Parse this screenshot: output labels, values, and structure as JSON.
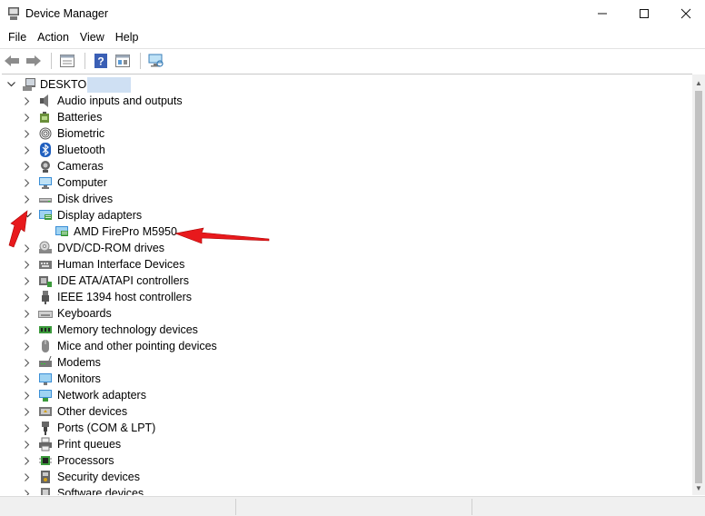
{
  "window": {
    "title": "Device Manager",
    "minimize_icon": "minimize-icon",
    "maximize_icon": "maximize-icon",
    "close_icon": "close-icon"
  },
  "menu": {
    "items": [
      {
        "label": "File"
      },
      {
        "label": "Action"
      },
      {
        "label": "View"
      },
      {
        "label": "Help"
      }
    ]
  },
  "toolbar": {
    "buttons": [
      "back-icon",
      "forward-icon",
      "properties-icon",
      "help-icon",
      "update-driver-icon",
      "scan-hardware-icon"
    ]
  },
  "tree": {
    "root": "DESKTOP-",
    "categories": [
      {
        "label": "Audio inputs and outputs",
        "icon": "speaker-icon"
      },
      {
        "label": "Batteries",
        "icon": "battery-icon"
      },
      {
        "label": "Biometric",
        "icon": "fingerprint-icon"
      },
      {
        "label": "Bluetooth",
        "icon": "bluetooth-icon"
      },
      {
        "label": "Cameras",
        "icon": "camera-icon"
      },
      {
        "label": "Computer",
        "icon": "computer-icon"
      },
      {
        "label": "Disk drives",
        "icon": "disk-drive-icon"
      },
      {
        "label": "Display adapters",
        "icon": "display-adapter-icon",
        "expanded": true,
        "children": [
          {
            "label": "AMD FirePro M5950",
            "icon": "display-adapter-icon"
          }
        ]
      },
      {
        "label": "DVD/CD-ROM drives",
        "icon": "dvd-drive-icon"
      },
      {
        "label": "Human Interface Devices",
        "icon": "hid-icon"
      },
      {
        "label": "IDE ATA/ATAPI controllers",
        "icon": "ide-controller-icon"
      },
      {
        "label": "IEEE 1394 host controllers",
        "icon": "firewire-icon"
      },
      {
        "label": "Keyboards",
        "icon": "keyboard-icon"
      },
      {
        "label": "Memory technology devices",
        "icon": "memory-icon"
      },
      {
        "label": "Mice and other pointing devices",
        "icon": "mouse-icon"
      },
      {
        "label": "Modems",
        "icon": "modem-icon"
      },
      {
        "label": "Monitors",
        "icon": "monitor-icon"
      },
      {
        "label": "Network adapters",
        "icon": "network-icon"
      },
      {
        "label": "Other devices",
        "icon": "other-devices-icon"
      },
      {
        "label": "Ports (COM & LPT)",
        "icon": "port-icon"
      },
      {
        "label": "Print queues",
        "icon": "printer-icon"
      },
      {
        "label": "Processors",
        "icon": "processor-icon"
      },
      {
        "label": "Security devices",
        "icon": "security-icon"
      },
      {
        "label": "Software devices",
        "icon": "software-device-icon"
      }
    ]
  },
  "annotations": {
    "arrow_color": "#e8191c"
  }
}
